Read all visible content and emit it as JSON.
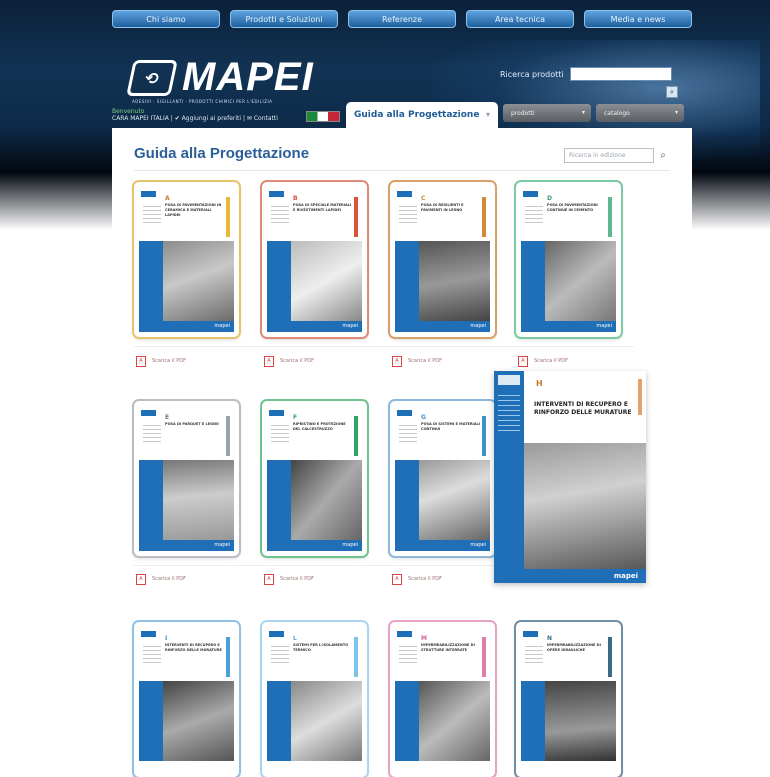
{
  "top_nav": [
    "Chi siamo",
    "Prodotti e Soluzioni",
    "Referenze",
    "Area tecnica",
    "Media e news"
  ],
  "brand": {
    "name": "MAPEI",
    "tagline": "ADESIVI · SIGILLANTI · PRODOTTI CHIMICI PER L'EDILIZIA"
  },
  "header_search": {
    "label": "Ricerca prodotti"
  },
  "subbar": {
    "top": "Benvenuto",
    "bottom": "CARA MAPEI ITALIA   |   ✔ Aggiungi ai preferiti   |   ✉ Contatti"
  },
  "tab": {
    "label": "Guida alla Progettazione"
  },
  "dropdowns": [
    "prodotti",
    "catalogo"
  ],
  "page": {
    "title": "Guida alla Progettazione",
    "search_placeholder": "Ricerca in edizione"
  },
  "covers": [
    {
      "letter": "A",
      "title": "POSA DI PAVIMENTAZIONI IN CERAMICA E MATERIALI LAPIDEI",
      "accent": "#e7b83a"
    },
    {
      "letter": "B",
      "title": "POSA DI SPECIALE MATERIALI E RIVESTIMENTI LAPIDEI",
      "accent": "#d8523c"
    },
    {
      "letter": "C",
      "title": "POSA DI RESILIENTI E PAVIMENTI IN LEGNO",
      "accent": "#d08a3a"
    },
    {
      "letter": "D",
      "title": "POSA DI PAVIMENTAZIONI CONTINUE IN CEMENTO",
      "accent": "#5fb88e"
    },
    {
      "letter": "E",
      "title": "POSA DI PARQUET E LEGNO",
      "accent": "#9aa3ad"
    },
    {
      "letter": "F",
      "title": "RIPRISTINO E PROTEZIONE DEL CALCESTRUZZO",
      "accent": "#2ea46a"
    },
    {
      "letter": "G",
      "title": "POSA DI SISTEMI E MATERIALI CONTINUI",
      "accent": "#3f8fd0"
    },
    {
      "letter": "I",
      "title": "INTERVENTI DI RECUPERO E RINFORZO DELLE MURATURE",
      "accent": "#4aa0d8"
    },
    {
      "letter": "L",
      "title": "SISTEMI PER L'ISOLAMENTO TERMICO",
      "accent": "#7ec3e8"
    },
    {
      "letter": "M",
      "title": "IMPERMEABILIZZAZIONE DI STRUTTURE INTERRATE",
      "accent": "#e07bb0"
    },
    {
      "letter": "N",
      "title": "IMPERMEABILIZZAZIONE DI OPERE IDRAULICHE",
      "accent": "#3a6b8a"
    }
  ],
  "download_label": "Scarica il PDF",
  "featured": {
    "letter": "H",
    "title": "INTERVENTI DI RECUPERO E RINFORZO DELLE MURATURE"
  },
  "footer_brand": "mapei"
}
